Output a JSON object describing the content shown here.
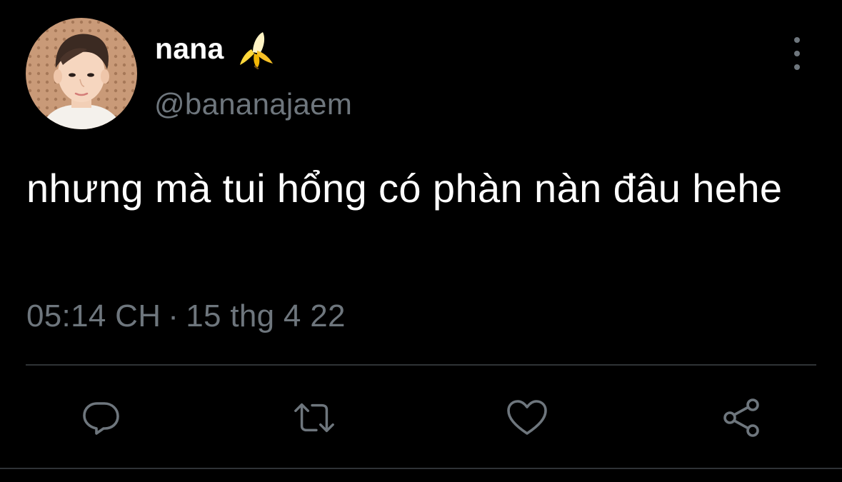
{
  "tweet": {
    "author": {
      "display_name": "nana",
      "emoji_icon": "banana-emoji-icon",
      "handle": "@bananajaem"
    },
    "text": "nhưng mà tui hổng có phàn nàn đâu hehe",
    "time": "05:14 CH",
    "separator": "·",
    "date": "15 thg 4 22",
    "actions": [
      "reply-icon",
      "retweet-icon",
      "like-icon",
      "share-icon"
    ],
    "more_icon": "more-vertical-icon"
  },
  "colors": {
    "background": "#000000",
    "primary_text": "#ffffff",
    "secondary_text": "#6e767d",
    "divider": "#2f3336",
    "banana": "#ffd83b"
  }
}
